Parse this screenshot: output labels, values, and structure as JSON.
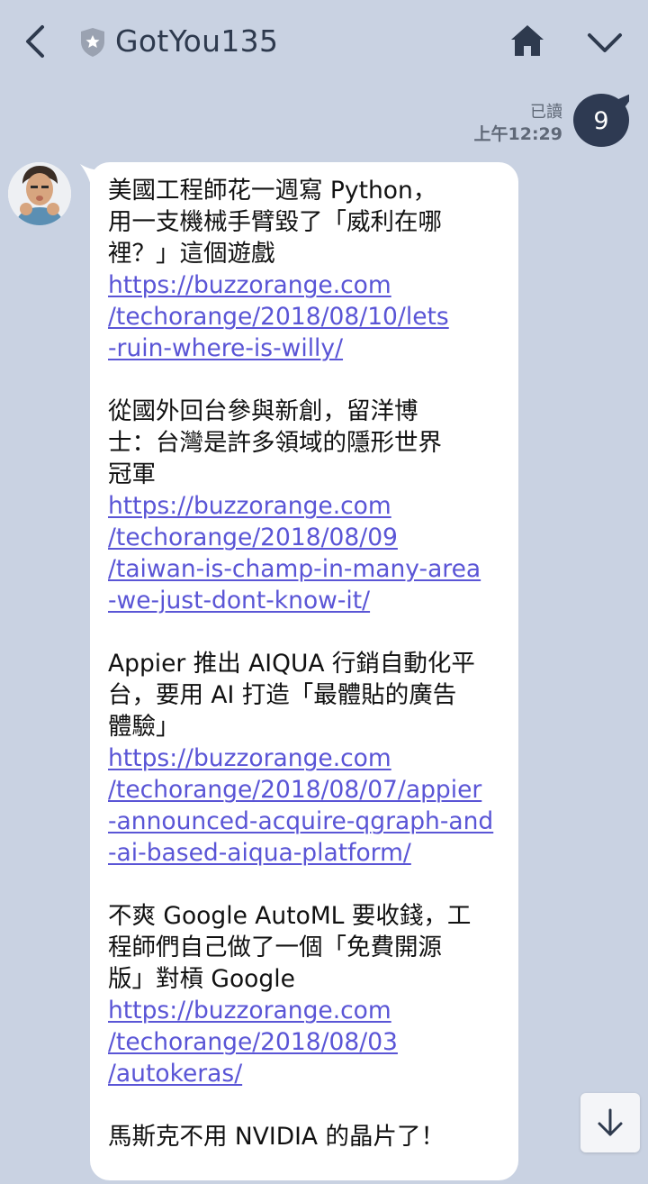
{
  "header": {
    "title": "GotYou135"
  },
  "read_status": {
    "label": "已讀",
    "time": "上午12:29"
  },
  "badge": {
    "count": "9"
  },
  "message": {
    "items": [
      {
        "title_lines": [
          "美國工程師花一週寫 Python，",
          "用一支機械手臂毀了「威利在哪",
          "裡？」這個遊戲"
        ],
        "link_lines": [
          "https://buzzorange.com",
          "/techorange/2018/08/10/lets",
          "-ruin-where-is-willy/"
        ]
      },
      {
        "title_lines": [
          "從國外回台參與新創，留洋博",
          "士：台灣是許多領域的隱形世界",
          "冠軍"
        ],
        "link_lines": [
          "https://buzzorange.com",
          "/techorange/2018/08/09",
          "/taiwan-is-champ-in-many-area",
          "-we-just-dont-know-it/"
        ]
      },
      {
        "title_lines": [
          "Appier 推出 AIQUA 行銷自動化平",
          "台，要用 AI 打造「最體貼的廣告",
          "體驗」"
        ],
        "link_lines": [
          "https://buzzorange.com",
          "/techorange/2018/08/07/appier",
          "-announced-acquire-qgraph-and",
          "-ai-based-aiqua-platform/"
        ]
      },
      {
        "title_lines": [
          "不爽 Google AutoML 要收錢，工",
          "程師們自己做了一個「免費開源",
          "版」對槓 Google"
        ],
        "link_lines": [
          "https://buzzorange.com",
          "/techorange/2018/08/03",
          "/autokeras/"
        ]
      },
      {
        "title_lines": [
          "馬斯克不用 NVIDIA 的晶片了！"
        ],
        "link_lines": []
      }
    ]
  },
  "colors": {
    "background": "#c9d2e2",
    "link": "#5a55d6",
    "badge": "#2e3a52",
    "bubble": "#ffffff"
  },
  "icons": {
    "back": "chevron-left-icon",
    "verified": "shield-icon",
    "home": "home-icon",
    "menu": "chevron-down-icon",
    "scroll": "arrow-down-icon"
  }
}
